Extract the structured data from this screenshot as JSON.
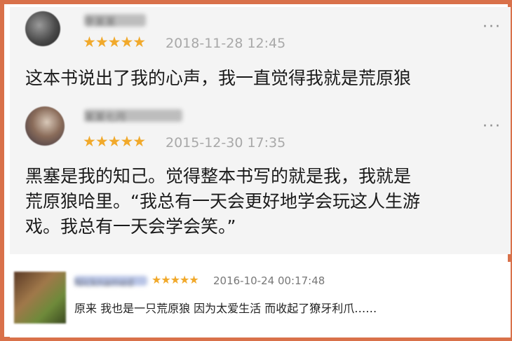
{
  "reviews": [
    {
      "username": "李某某",
      "stars": "★★★★★",
      "timestamp": "2018-11-28 12:45",
      "more": "···",
      "text_lines": [
        "这本书说出了我的心声，我一直觉得我就是荒原狼"
      ]
    },
    {
      "username": "某某七月",
      "stars": "★★★★★",
      "timestamp": "2015-12-30 17:35",
      "more": "···",
      "text_lines": [
        "黑塞是我的知己。觉得整本书写的就是我，我就是",
        "荒原狼哈里。“我总有一天会更好地学会玩这人生游",
        "戏。我总有一天会学会笑。”"
      ]
    },
    {
      "username": "Nicknamed",
      "stars": "★★★★★",
      "timestamp": "2016-10-24 00:17:48",
      "text_lines": [
        "原来 我也是一只荒原狼 因为太爱生活 而收起了獠牙利爪……"
      ]
    }
  ],
  "colors": {
    "frame": "#d9714a",
    "star": "#f1a92b",
    "timestamp": "#a8a8a8"
  }
}
